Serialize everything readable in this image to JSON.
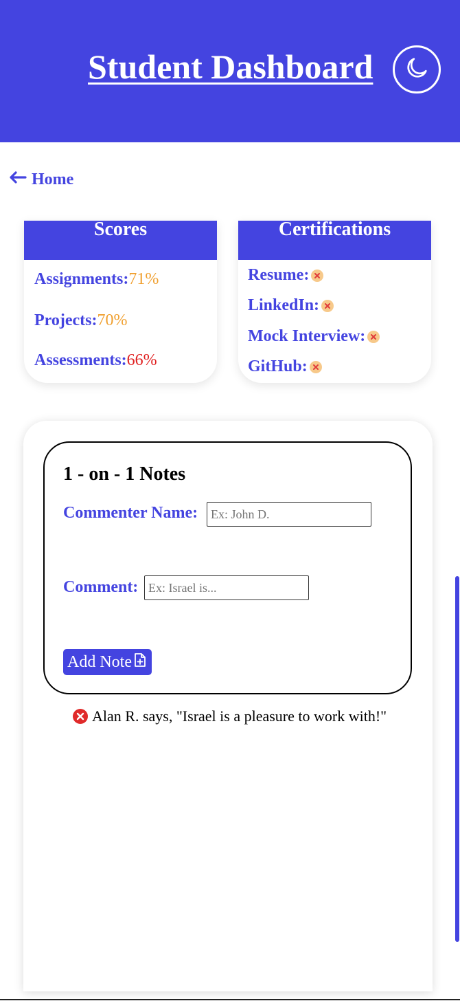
{
  "header": {
    "title": "Student Dashboard",
    "theme_icon": "moon-icon",
    "color": "#4444e0"
  },
  "nav": {
    "home_label": "Home",
    "home_icon": "arrow-left-icon"
  },
  "scores": {
    "title": "Scores",
    "items": [
      {
        "label": "Assignments:",
        "value": "71%",
        "color": "#f0a030"
      },
      {
        "label": "Projects:",
        "value": "70%",
        "color": "#f0a030"
      },
      {
        "label": "Assessments:",
        "value": "66%",
        "color": "#e02020"
      }
    ]
  },
  "certifications": {
    "title": "Certifications",
    "items": [
      {
        "label": "Resume:",
        "status_icon": "x-badge-icon"
      },
      {
        "label": "LinkedIn:",
        "status_icon": "x-badge-icon"
      },
      {
        "label": "Mock Interview:",
        "status_icon": "x-badge-icon"
      },
      {
        "label": "GitHub:",
        "status_icon": "x-badge-icon"
      }
    ]
  },
  "notes": {
    "title": "1 - on - 1 Notes",
    "commenter_label": "Commenter Name:",
    "commenter_placeholder": "Ex: John D.",
    "commenter_value": "",
    "comment_label": "Comment:",
    "comment_placeholder": "Ex: Israel is...",
    "comment_value": "",
    "add_button": "Add Note",
    "entries": [
      {
        "text": "Alan R. says, \"Israel is a pleasure to work with!\"",
        "delete_icon": "x-circle-icon"
      }
    ]
  }
}
